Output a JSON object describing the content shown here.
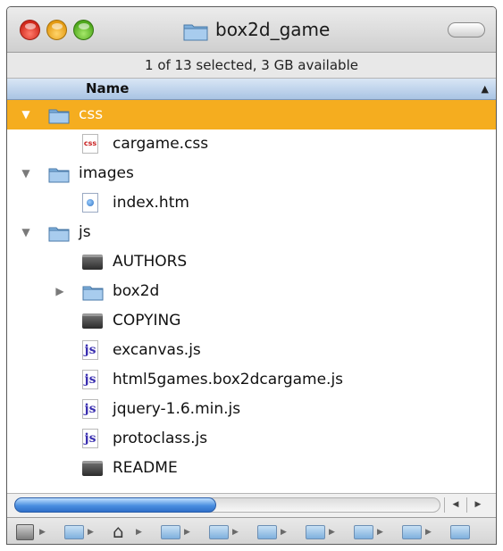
{
  "window": {
    "title": "box2d_game",
    "status": "1 of 13 selected, 3 GB available"
  },
  "colors": {
    "selection": "#f5ad1f",
    "folder": "#7fb0dd",
    "header": "#a9c4e4",
    "scroll_thumb": "#4a8fe0"
  },
  "header": {
    "name_label": "Name",
    "sort_icon": "sort-ascending-icon"
  },
  "files": [
    {
      "name": "css",
      "icon": "folder-icon",
      "disclosure": "expanded",
      "selected": true
    },
    {
      "name": "cargame.css",
      "icon": "css-file-icon",
      "icon_text": "css",
      "disclosure": "none",
      "selected": false
    },
    {
      "name": "images",
      "icon": "folder-icon",
      "disclosure": "expanded",
      "selected": false
    },
    {
      "name": "index.htm",
      "icon": "html-file-icon",
      "disclosure": "none",
      "selected": false
    },
    {
      "name": "js",
      "icon": "folder-icon",
      "disclosure": "expanded",
      "selected": false
    },
    {
      "name": "AUTHORS",
      "icon": "unix-executable-icon",
      "disclosure": "none",
      "selected": false
    },
    {
      "name": "box2d",
      "icon": "folder-icon",
      "disclosure": "collapsed",
      "selected": false
    },
    {
      "name": "COPYING",
      "icon": "unix-executable-icon",
      "disclosure": "none",
      "selected": false
    },
    {
      "name": "excanvas.js",
      "icon": "js-file-icon",
      "icon_text": "js",
      "disclosure": "none",
      "selected": false
    },
    {
      "name": "html5games.box2dcargame.js",
      "icon": "js-file-icon",
      "icon_text": "js",
      "disclosure": "none",
      "selected": false
    },
    {
      "name": "jquery-1.6.min.js",
      "icon": "js-file-icon",
      "icon_text": "js",
      "disclosure": "none",
      "selected": false
    },
    {
      "name": "protoclass.js",
      "icon": "js-file-icon",
      "icon_text": "js",
      "disclosure": "none",
      "selected": false
    },
    {
      "name": "README",
      "icon": "unix-executable-icon",
      "disclosure": "none",
      "selected": false
    }
  ],
  "disclosure_glyphs": {
    "expanded": "▼",
    "collapsed": "▶"
  },
  "scrollbar": {
    "left_arrow": "◀",
    "right_arrow": "▶"
  },
  "pathbar": {
    "items": [
      "hard-drive-icon",
      "user-folder-icon",
      "home-icon",
      "documents-folder-icon",
      "folder-icon",
      "folder-icon",
      "folder-icon",
      "folder-icon",
      "folder-icon",
      "folder-icon"
    ],
    "separator": "▶",
    "home_glyph": "⌂"
  }
}
